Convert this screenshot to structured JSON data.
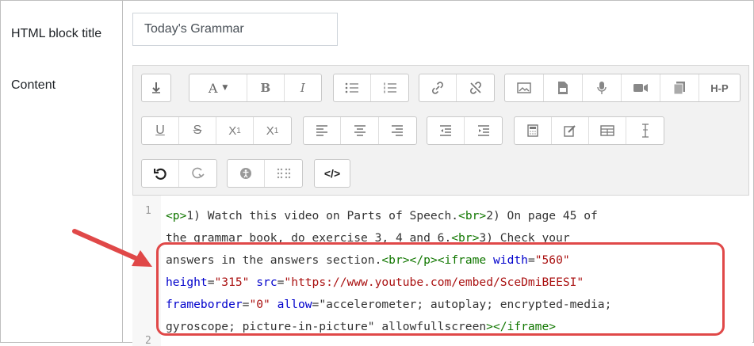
{
  "form": {
    "title_label": "HTML block title",
    "title_value": "Today's Grammar",
    "content_label": "Content"
  },
  "toolbar": {
    "rows": [
      [
        [
          "show-more"
        ],
        [
          "paragraph-style",
          "bold",
          "italic"
        ],
        [
          "unordered-list",
          "ordered-list"
        ],
        [
          "link",
          "unlink"
        ],
        [
          "image",
          "media",
          "record-audio",
          "record-video",
          "manage-files",
          "h5p"
        ]
      ],
      [
        [
          "underline",
          "strikethrough",
          "subscript",
          "superscript"
        ],
        [
          "align-left",
          "align-center",
          "align-right"
        ],
        [
          "outdent",
          "indent"
        ],
        [
          "equation",
          "insert-character",
          "table",
          "clear-formatting"
        ]
      ],
      [
        [
          "undo",
          "redo"
        ],
        [
          "accessibility-checker",
          "screenreader-helper"
        ],
        [
          "html-source"
        ]
      ]
    ],
    "labels": {
      "bold": "B",
      "italic": "I",
      "format": "A",
      "h5p": "H-P"
    }
  },
  "editor": {
    "line_number": "1",
    "next_line_number": "2",
    "lines": [
      "<p>1) Watch this video on Parts of Speech.<br>2) On page 45 of",
      "the grammar book, do exercise 3, 4 and 6.<br>3) Check your",
      "answers in the answers section.<br></p><iframe width=\"560\"",
      "height=\"315\" src=\"https://www.youtube.com/embed/SceDmiBEESI\"",
      "frameborder=\"0\" allow=\"accelerometer; autoplay; encrypted-media;",
      "gyroscope; picture-in-picture\" allowfullscreen></iframe>"
    ]
  },
  "annotation": {
    "arrow_color": "#e04848",
    "box_color": "#e04848"
  }
}
